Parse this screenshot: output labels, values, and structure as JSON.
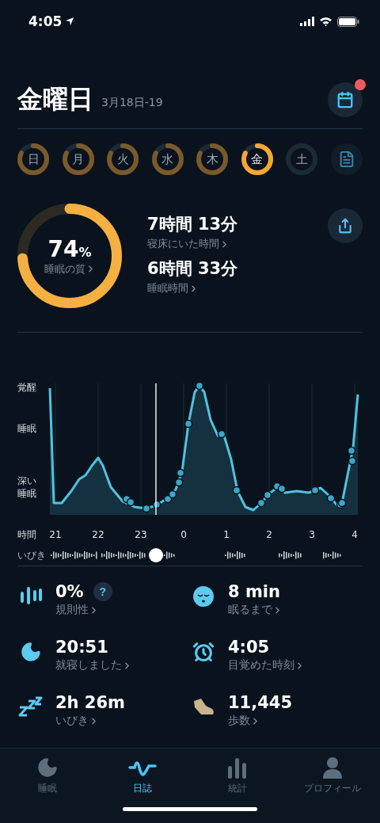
{
  "status_bar": {
    "time": "4:05"
  },
  "header": {
    "title": "金曜日",
    "date_range": "3月18日-19",
    "calendar_badge": true
  },
  "days": [
    {
      "label": "日",
      "has_data": true,
      "selected": false
    },
    {
      "label": "月",
      "has_data": true,
      "selected": false
    },
    {
      "label": "火",
      "has_data": true,
      "selected": false
    },
    {
      "label": "水",
      "has_data": true,
      "selected": false
    },
    {
      "label": "木",
      "has_data": true,
      "selected": false
    },
    {
      "label": "金",
      "has_data": true,
      "selected": true
    },
    {
      "label": "土",
      "has_data": false,
      "selected": false
    }
  ],
  "summary": {
    "quality": {
      "value": "74",
      "unit": "%",
      "label": "睡眠の質",
      "level": 0.74
    },
    "stats": [
      {
        "value": "7時間 13分",
        "label": "寝床にいた時間"
      },
      {
        "value": "6時間 33分",
        "label": "睡眠時間"
      }
    ]
  },
  "chart": {
    "y_labels": [
      "覚醒",
      "睡眠",
      "深い睡眠"
    ],
    "x_axis_label": "時間",
    "hours": [
      "21",
      "22",
      "23",
      "0",
      "1",
      "2",
      "3",
      "4"
    ],
    "snore_label": "いびき"
  },
  "metrics": [
    {
      "kind": "bars",
      "value": "0%",
      "label": "規則性",
      "help": "?"
    },
    {
      "kind": "face",
      "value": "8 min",
      "label": "眠るまで"
    },
    {
      "kind": "moon",
      "value": "20:51",
      "label": "就寝しました"
    },
    {
      "kind": "alarm",
      "value": "4:05",
      "label": "目覚めた時刻"
    },
    {
      "kind": "zzz",
      "value": "2h 26m",
      "label": "いびき"
    },
    {
      "kind": "shoe",
      "value": "11,445",
      "label": "歩数"
    }
  ],
  "tabs": [
    {
      "kind": "moon",
      "label": "睡眠",
      "selected": false
    },
    {
      "kind": "wave",
      "label": "日誌",
      "selected": true
    },
    {
      "kind": "bars",
      "label": "統計",
      "selected": false
    },
    {
      "kind": "person",
      "label": "プロフィール",
      "selected": false
    }
  ]
}
